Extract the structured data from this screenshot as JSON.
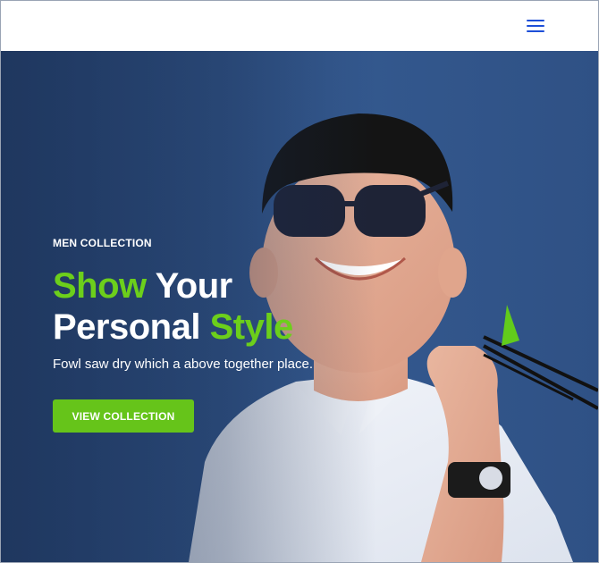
{
  "header": {
    "menu_icon": "hamburger-menu-icon",
    "accent_color": "#1d4fd8"
  },
  "hero": {
    "eyebrow": "MEN COLLECTION",
    "headline": {
      "word1": "Show",
      "word2": "Your",
      "word3": "Personal",
      "word4": "Style"
    },
    "subtitle": "Fowl saw dry which a above together place.",
    "cta_label": "VIEW COLLECTION",
    "accent_color": "#6ccf1b",
    "button_color": "#66c41a"
  }
}
